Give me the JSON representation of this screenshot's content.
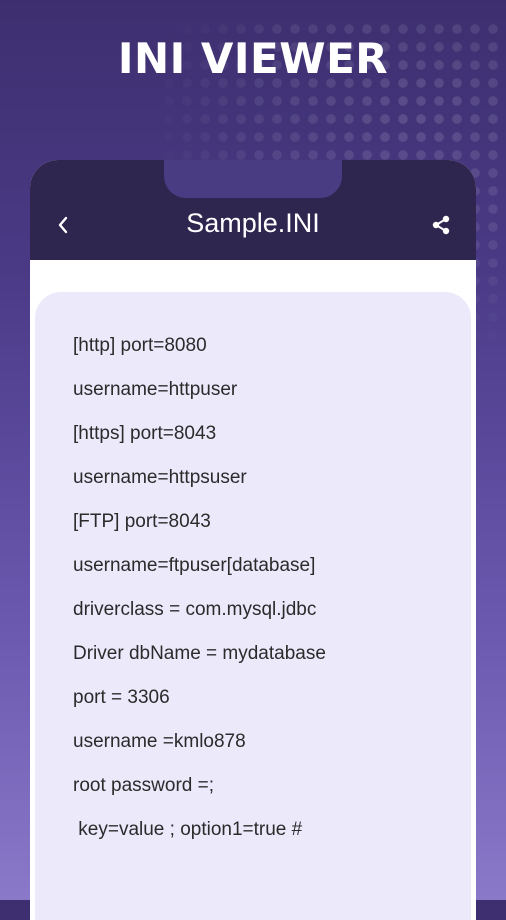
{
  "headline": "INI VIEWER",
  "appbar": {
    "title": "Sample.INI",
    "back_icon": "chevron-left-icon",
    "share_icon": "share-icon"
  },
  "file_lines": [
    "[http] port=8080",
    "username=httpuser",
    "[https] port=8043",
    "username=httpsuser",
    "[FTP] port=8043",
    "username=ftpuser[database]",
    "driverclass = com.mysql.jdbc",
    "Driver dbName = mydatabase",
    "port = 3306",
    "username =kmlo878",
    "root password =;",
    " key=value ; option1=true #"
  ],
  "colors": {
    "appbar": "#2f2650",
    "content_bg": "#ece9fb",
    "text": "#2b2b2b"
  }
}
